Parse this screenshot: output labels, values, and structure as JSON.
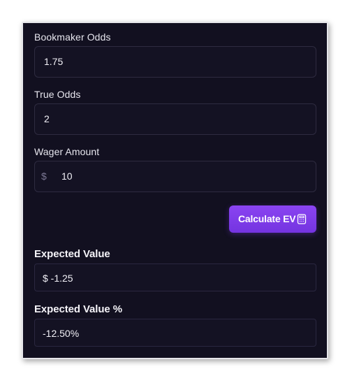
{
  "form": {
    "bookmaker_odds_label": "Bookmaker Odds",
    "bookmaker_odds_value": "1.75",
    "true_odds_label": "True Odds",
    "true_odds_value": "2",
    "wager_amount_label": "Wager Amount",
    "wager_currency_symbol": "$",
    "wager_amount_value": "10"
  },
  "actions": {
    "calculate_label": "Calculate EV",
    "calculate_icon": "calculator-icon"
  },
  "results": {
    "expected_value_heading": "Expected Value",
    "expected_value": "$ -1.25",
    "expected_value_pct_heading": "Expected Value %",
    "expected_value_pct": "-12.50%"
  },
  "colors": {
    "panel_background": "#121020",
    "field_border": "#2e2b40",
    "accent": "#7e3cea",
    "text": "#f1f0f6",
    "muted": "#7c7894"
  }
}
